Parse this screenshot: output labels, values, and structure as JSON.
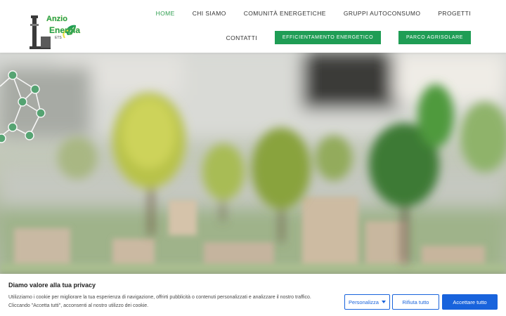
{
  "header": {
    "logo": {
      "line1": "Anzio",
      "line2": "Energia",
      "line3": "ETS",
      "colors": {
        "green": "#1f9d55",
        "yellow": "#e8e23a",
        "dark": "#3a3a3a"
      }
    },
    "nav_top": [
      {
        "label": "HOME",
        "active": true
      },
      {
        "label": "CHI SIAMO",
        "active": false
      },
      {
        "label": "COMUNITÀ ENERGETICHE",
        "active": false
      },
      {
        "label": "GRUPPI AUTOCONSUMO",
        "active": false
      },
      {
        "label": "PROGETTI",
        "active": false
      }
    ],
    "nav_bottom": {
      "contatti": "CONTATTI",
      "efficientamento": "EFFICIENTAMENTO ENERGETICO",
      "parco": "PARCO AGRISOLARE"
    },
    "colors": {
      "accent": "#1f9d55",
      "active_text": "#2e9e4f",
      "text": "#333333"
    }
  },
  "hero": {
    "description_icon": "blurred-city-model-with-trees",
    "network_icon": "community-network-icon"
  },
  "cookie_banner": {
    "title": "Diamo valore alla tua privacy",
    "text": "Utilizziamo i cookie per migliorare la tua esperienza di navigazione, offrirti pubblicità o contenuti personalizzati e analizzare il nostro traffico. Cliccando \"Accetta tutti\", acconsenti al nostro utilizzo dei cookie.",
    "buttons": {
      "customize": "Personalizza",
      "reject": "Rifiuta tutto",
      "accept": "Accettare tutto"
    },
    "colors": {
      "button_blue": "#1863dc"
    }
  }
}
